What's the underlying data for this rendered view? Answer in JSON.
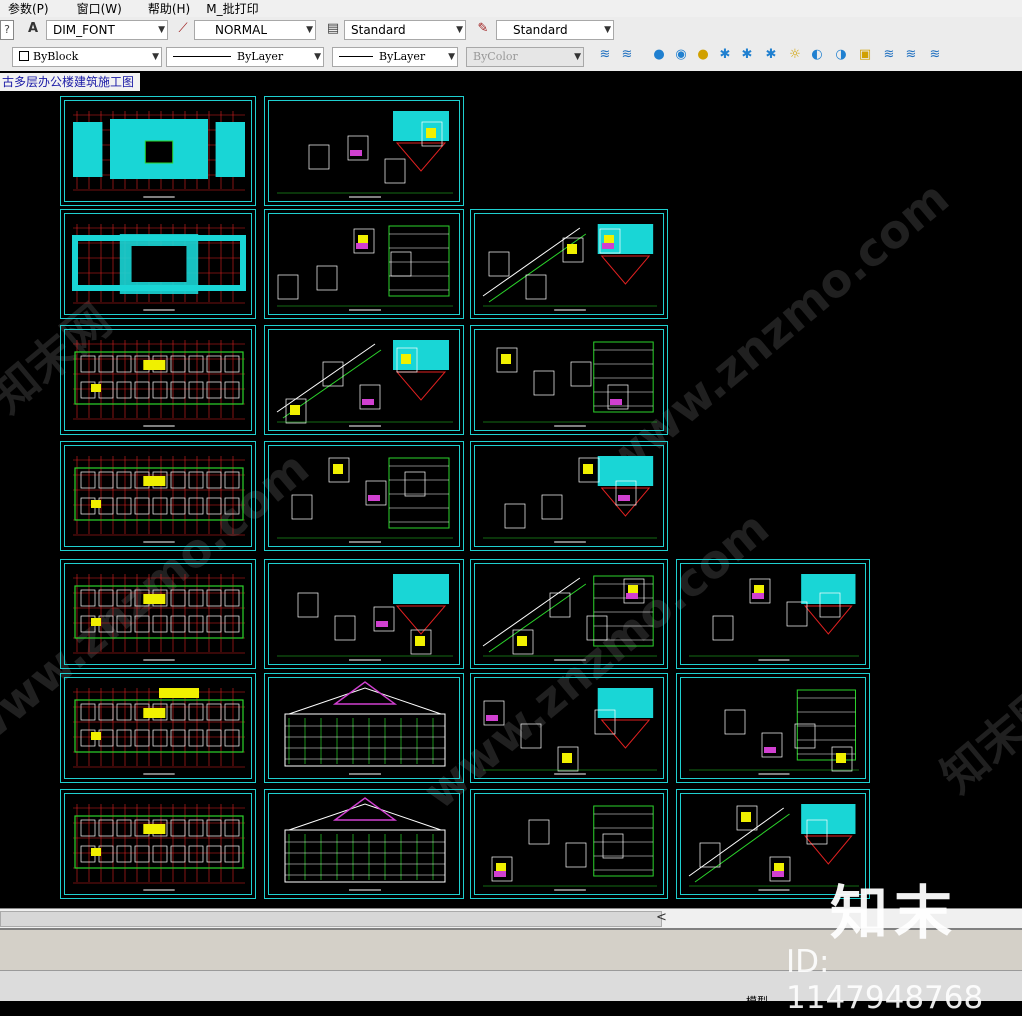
{
  "menu": {
    "items": [
      "参数(P)",
      "窗口(W)",
      "帮助(H)",
      "M_批打印"
    ]
  },
  "toolbar1": {
    "help_button": "?",
    "text_style": "DIM_FONT",
    "dim_style": "NORMAL",
    "table_style": "Standard",
    "multileader_style": "Standard"
  },
  "toolbar2": {
    "color": "ByBlock",
    "linetype": "ByLayer",
    "lineweight": "ByLayer",
    "plotstyle": "ByColor"
  },
  "document_tab": {
    "title": "古多层办公楼建筑施工图"
  },
  "watermark": {
    "url_text": "www.znzmo.com",
    "brand_text": "知末网"
  },
  "overlay": {
    "logo_text": "知末",
    "id_text": "ID: 1147948768"
  },
  "status_bar": {
    "model_tab": "模型"
  },
  "colors": {
    "sheet_border": "#1fd0d0",
    "wall_cyan": "#19d6d6",
    "line_green": "#2bd42b",
    "grid_red": "#e02020",
    "fill_yellow": "#f0f000",
    "accent_magenta": "#d040d0"
  }
}
